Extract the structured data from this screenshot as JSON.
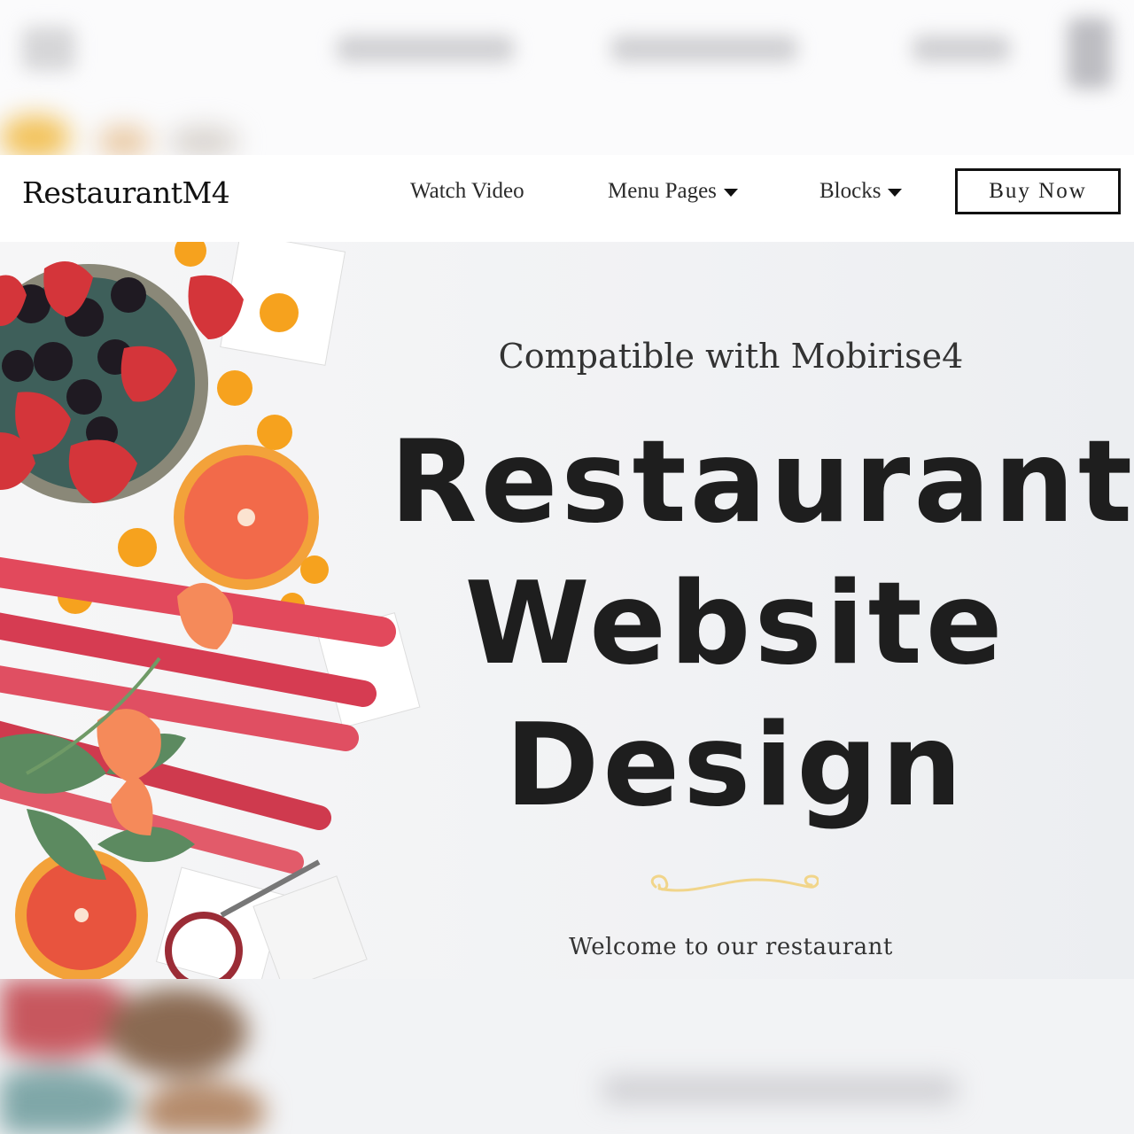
{
  "nav": {
    "brand": "RestaurantM4",
    "items": [
      {
        "label": "Watch Video",
        "dropdown": false
      },
      {
        "label": "Menu Pages",
        "dropdown": true
      },
      {
        "label": "Blocks",
        "dropdown": true
      }
    ],
    "cta": "Buy Now"
  },
  "hero": {
    "subtitle": "Compatible with Mobirise4",
    "title_lines": [
      "Restaurant",
      "Website",
      "Design"
    ],
    "welcome": "Welcome to our restaurant",
    "flourish_color": "#f1d58a"
  }
}
